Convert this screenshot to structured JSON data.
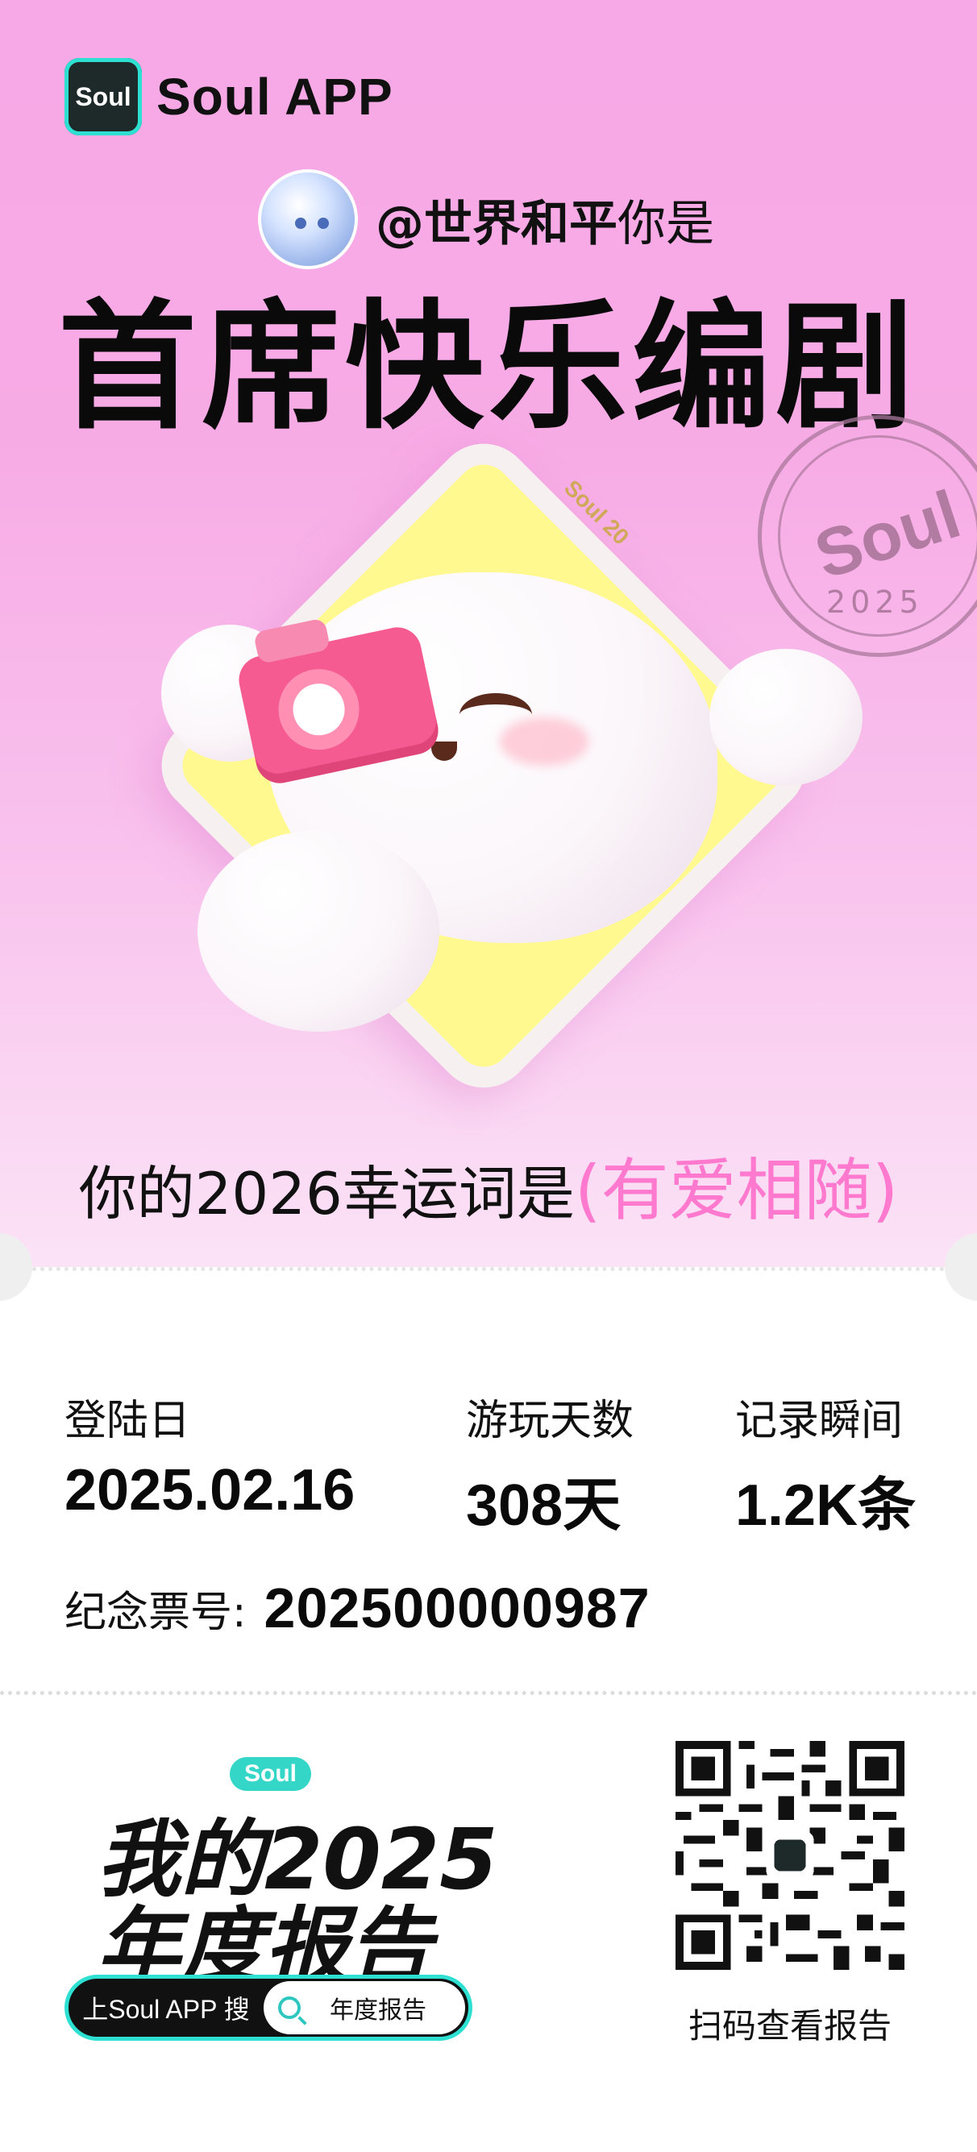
{
  "brand": {
    "icon_text": "Soul",
    "name": "Soul APP"
  },
  "user": {
    "handle_bold": "@世界和平",
    "handle_rest": "你是"
  },
  "headline": "首席快乐编剧",
  "art": {
    "diamond_text": "Soul 20",
    "stamp_word": "Soul",
    "stamp_year": "2025"
  },
  "lucky": {
    "prefix": "你的2026幸运词是",
    "word": "(有爱相随)"
  },
  "stats": [
    {
      "label": "登陆日",
      "value": "2025.02.16"
    },
    {
      "label": "游玩天数",
      "value": "308天"
    },
    {
      "label": "记录瞬间",
      "value": "1.2K条"
    }
  ],
  "ticket": {
    "label": "纪念票号:",
    "number": "202500000987"
  },
  "report_logo": {
    "bubble": "Soul",
    "line1": "我的2025",
    "line2": "年度报告"
  },
  "search": {
    "left_label": "上Soul APP 搜",
    "query": "年度报告"
  },
  "qr": {
    "caption": "扫码查看报告"
  },
  "colors": {
    "accent_pink": "#ff79cf",
    "brand_teal": "#2ee0d2",
    "background_pink": "#f7a8e6"
  }
}
